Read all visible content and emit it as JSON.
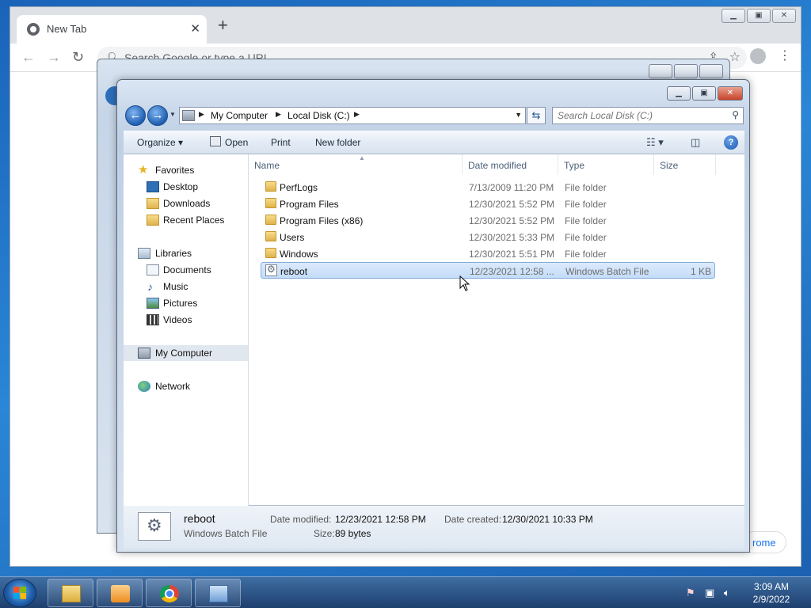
{
  "chrome": {
    "tab_title": "New Tab",
    "tab_close": "✕",
    "new_tab": "+",
    "omnibox_placeholder": "Search Google or type a URL",
    "customize_label": "rome"
  },
  "explorer": {
    "breadcrumb": [
      "My Computer",
      "Local Disk (C:)"
    ],
    "search_placeholder": "Search Local Disk (C:)",
    "commands": {
      "organize": "Organize",
      "open": "Open",
      "print": "Print",
      "new_folder": "New folder"
    },
    "nav": {
      "favorites": "Favorites",
      "desktop": "Desktop",
      "downloads": "Downloads",
      "recent_places": "Recent Places",
      "libraries": "Libraries",
      "documents": "Documents",
      "music": "Music",
      "pictures": "Pictures",
      "videos": "Videos",
      "my_computer": "My Computer",
      "network": "Network"
    },
    "columns": {
      "name": "Name",
      "date_modified": "Date modified",
      "type": "Type",
      "size": "Size"
    },
    "files": [
      {
        "name": "PerfLogs",
        "date": "7/13/2009 11:20 PM",
        "type": "File folder",
        "size": ""
      },
      {
        "name": "Program Files",
        "date": "12/30/2021 5:52 PM",
        "type": "File folder",
        "size": ""
      },
      {
        "name": "Program Files (x86)",
        "date": "12/30/2021 5:52 PM",
        "type": "File folder",
        "size": ""
      },
      {
        "name": "Users",
        "date": "12/30/2021 5:33 PM",
        "type": "File folder",
        "size": ""
      },
      {
        "name": "Windows",
        "date": "12/30/2021 5:51 PM",
        "type": "File folder",
        "size": ""
      },
      {
        "name": "reboot",
        "date": "12/23/2021 12:58 ...",
        "type": "Windows Batch File",
        "size": "1 KB"
      }
    ],
    "details": {
      "name": "reboot",
      "type": "Windows Batch File",
      "date_modified_label": "Date modified:",
      "date_modified": "12/23/2021 12:58 PM",
      "date_created_label": "Date created:",
      "date_created": "12/30/2021 10:33 PM",
      "size_label": "Size:",
      "size": "89 bytes"
    }
  },
  "taskbar": {
    "time": "3:09 AM",
    "date": "2/9/2022"
  }
}
